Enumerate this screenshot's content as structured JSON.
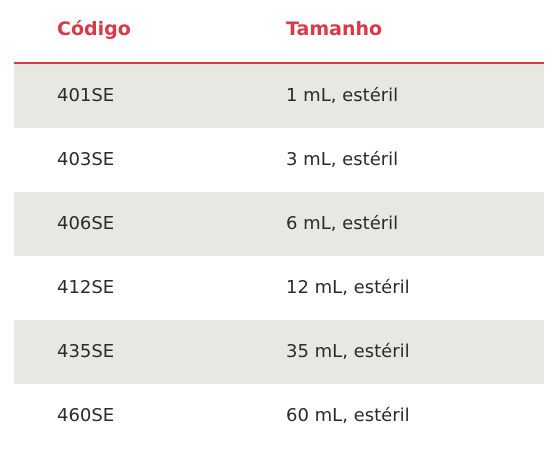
{
  "table": {
    "headers": {
      "code": "Código",
      "size": "Tamanho"
    },
    "rows": [
      {
        "code": "401SE",
        "size": "1 mL, estéril"
      },
      {
        "code": "403SE",
        "size": "3 mL, estéril"
      },
      {
        "code": "406SE",
        "size": "6 mL, estéril"
      },
      {
        "code": "412SE",
        "size": "12 mL, estéril"
      },
      {
        "code": "435SE",
        "size": "35 mL, estéril"
      },
      {
        "code": "460SE",
        "size": "60 mL, estéril"
      }
    ]
  },
  "colors": {
    "header_text": "#d83a48",
    "row_shade": "#e9e7e2",
    "body_text": "#2b2b2b"
  }
}
